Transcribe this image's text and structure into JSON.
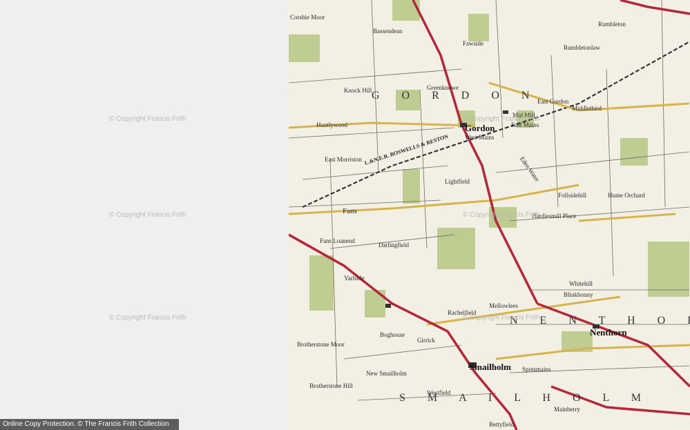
{
  "watermarks": [
    "© Copyright Francis Frith",
    "© Copyright Francis Frith",
    "© Copyright Francis Frith",
    "© Copyright Francis Frith",
    "© Copyright Francis Frith",
    "© Copyright Francis Frith"
  ],
  "footer": {
    "text": "Online Copy Protection. © The Francis Frith Collection"
  },
  "map": {
    "labels": {
      "gordon": "Gordon",
      "smailholm": "Smailholm",
      "nenthorn": "Nenthorn",
      "fans": "Fans",
      "fans_loanend": "Fans Loanend",
      "darlingfield": "Darlingfield",
      "lightfield": "Lightfield",
      "east_gordon": "East Gordon",
      "middlethird": "Middlethird",
      "rumbleton": "Rumbleton",
      "rumbletonlaw": "Rumbletonlaw",
      "hume_orchard": "Hume Orchard",
      "follsidehill": "Follsidehill",
      "hardiesmill_place": "Hardiesmill Place",
      "whitehill": "Whitehill",
      "blinkbonny": "Blinkbonny",
      "mellowlees": "Mellowlees",
      "rachelfield": "Rachelfield",
      "girrick": "Girrick",
      "boghouse": "Boghouse",
      "yarlside": "Yarlside",
      "brotherstone_moor": "Brotherstone Moor",
      "brotherstone_hill": "Brotherstone Hill",
      "new_smailholm": "New Smailholm",
      "westfield": "Westfield",
      "spotsmains": "Spotsmains",
      "mainberry": "Mainberry",
      "bettyfield": "Bettyfield",
      "fawside": "Fawside",
      "bassendean": "Bassendean",
      "corsbie_moor": "Corsbie Moor",
      "east_morriston": "East Morriston",
      "huntlywood": "Huntlywood",
      "knock_hill": "Knock Hill",
      "greenknowe": "Greenknowe",
      "mid_mill": "Mid Mill",
      "east_mains": "East Mains",
      "west_mains": "West Mains",
      "eden_water": "Eden Water",
      "parish_gordon": "G O R D O N",
      "parish_nenthorn": "N E N T H O R N",
      "parish_smailholm": "S M A I L H O L M",
      "rail_line": "L.&N.E.R. BOSWELLS & RESTON"
    },
    "colors": {
      "paper": "#f2efe5",
      "woodland": "#b9c98a",
      "road_major": "#b4283c",
      "road_minor": "#d8b24a",
      "field_line": "#6b6b5a",
      "railway": "#333333"
    }
  }
}
